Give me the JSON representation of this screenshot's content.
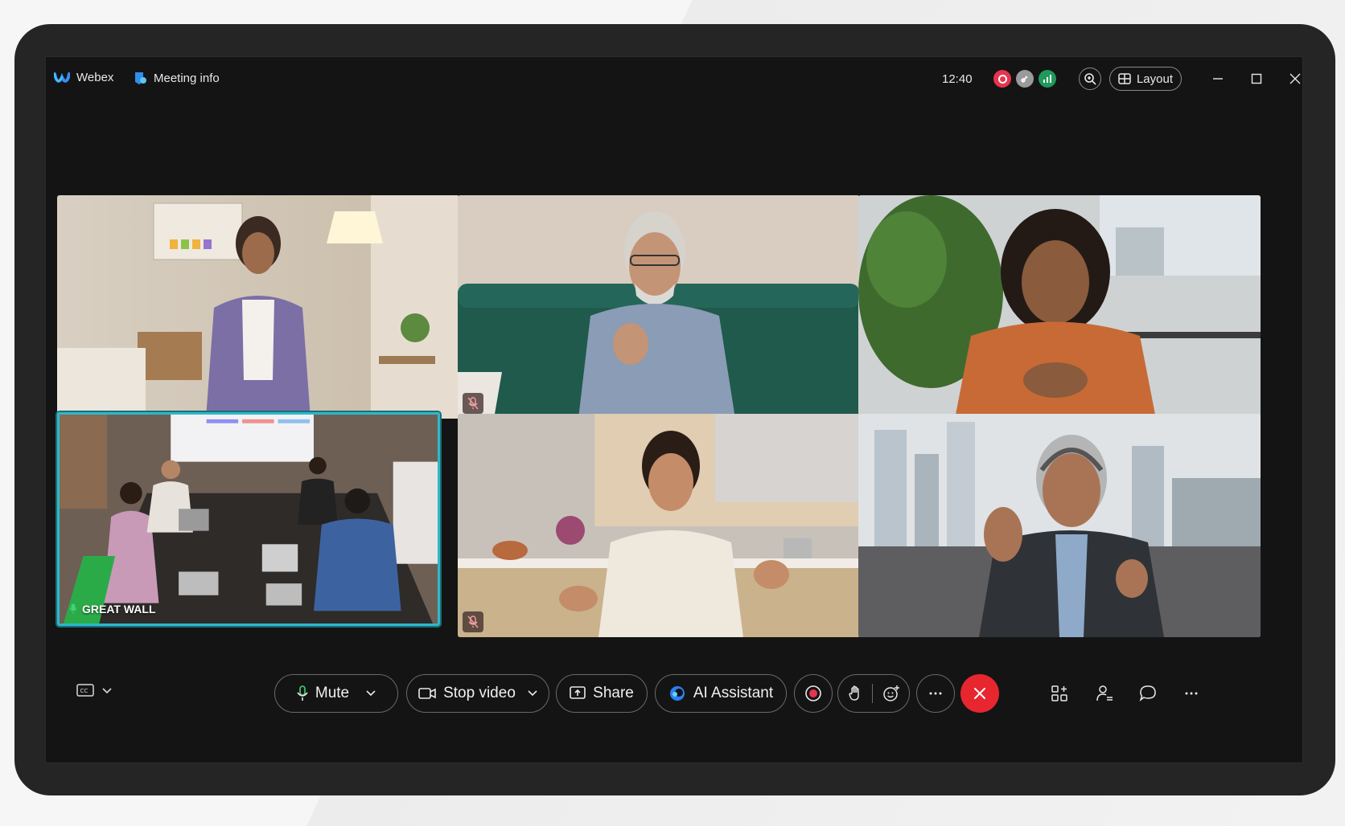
{
  "titlebar": {
    "app_name": "Webex",
    "meeting_info_label": "Meeting info",
    "time": "12:40",
    "layout_label": "Layout"
  },
  "participants": [
    {
      "id": "p1",
      "muted": false,
      "label": ""
    },
    {
      "id": "p2",
      "muted": true,
      "label": ""
    },
    {
      "id": "p3",
      "muted": false,
      "label": ""
    },
    {
      "id": "p4",
      "muted": false,
      "label": "GREAT WALL",
      "active_speaker": true
    },
    {
      "id": "p5",
      "muted": true,
      "label": ""
    },
    {
      "id": "p6",
      "muted": false,
      "label": ""
    }
  ],
  "controls": {
    "mute_label": "Mute",
    "stop_video_label": "Stop video",
    "share_label": "Share",
    "ai_assistant_label": "AI Assistant"
  },
  "colors": {
    "accent_active": "#2fb8c8",
    "end_call": "#e8262f",
    "recording": "#e8344e",
    "network": "#1f9a5a"
  },
  "icons": [
    "webex-logo-icon",
    "meeting-info-icon",
    "recording-icon",
    "lock-icon",
    "network-stats-icon",
    "zoom-icon",
    "layout-icon",
    "minimize-icon",
    "maximize-icon",
    "close-icon",
    "captions-icon",
    "microphone-icon",
    "camera-icon",
    "share-icon",
    "ai-assistant-icon",
    "record-icon",
    "raise-hand-icon",
    "reactions-icon",
    "more-icon",
    "end-call-icon",
    "apps-icon",
    "participants-icon",
    "chat-icon",
    "overflow-icon"
  ]
}
